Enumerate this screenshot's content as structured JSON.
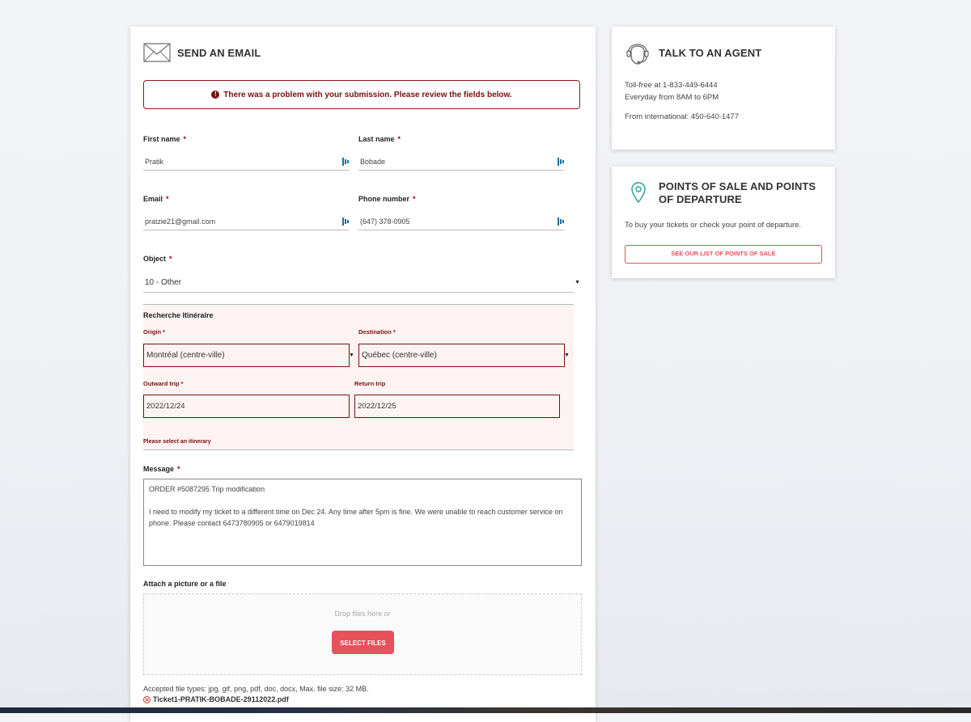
{
  "form": {
    "title": "SEND AN EMAIL",
    "error_message": "There was a problem with your submission. Please review the fields below.",
    "first_name": {
      "label": "First name",
      "required": "*",
      "value": "Pratik"
    },
    "last_name": {
      "label": "Last name",
      "required": "*",
      "value": "Bobade"
    },
    "email": {
      "label": "Email",
      "required": "*",
      "value": "pratzie21@gmail.com"
    },
    "phone": {
      "label": "Phone number",
      "required": "*",
      "value": "(647) 378-0905"
    },
    "object": {
      "label": "Object",
      "required": "*",
      "value": "10 - Other"
    },
    "itinerary": {
      "title": "Recherche Itinéraire",
      "origin_label": "Origin *",
      "origin_value": "Montréal (centre-ville)",
      "destination_label": "Destination *",
      "destination_value": "Québec (centre-ville)",
      "outward_label": "Outward trip *",
      "outward_value": "2022/12/24",
      "return_label": "Return trip",
      "return_value": "2022/12/25",
      "error": "Please select an itinerary"
    },
    "message": {
      "label": "Message",
      "required": "*",
      "line1": "ORDER #5087295 Trip modification",
      "line2": "I need to modify my ticket to a different time on Dec 24. Any time after 5pm is fine. We were unable to reach customer service on phone. Please contact 6473780905 or 6479019814"
    },
    "attach": {
      "label": "Attach a picture or a file",
      "drop_text": "Drop files here or",
      "button": "SELECT FILES",
      "accepted": "Accepted file types: jpg, gif, png, pdf, doc, docx, Max. file size: 32 MB.",
      "file_name": "Ticket1-PRATIK-BOBADE-29112022.pdf"
    }
  },
  "agent": {
    "title": "TALK TO AN AGENT",
    "tollfree": "Toll-free at 1-833-449-6444",
    "hours": "Everyday from 8AM to 6PM",
    "international": "From international: 450-640-1477"
  },
  "points": {
    "title_line1": "POINTS OF SALE AND POINTS",
    "title_line2": "OF DEPARTURE",
    "description": "To buy your tickets or check your point of departure.",
    "button": "SEE OUR LIST OF POINTS OF SALE"
  },
  "colors": {
    "accent": "#e8505b",
    "error": "#7a0f0f",
    "pin": "#2aa39a"
  },
  "icons": [
    "envelope-icon",
    "headset-icon",
    "location-pin-icon",
    "autofill-icon",
    "error-icon",
    "remove-file-icon",
    "dropdown-caret-icon"
  ]
}
